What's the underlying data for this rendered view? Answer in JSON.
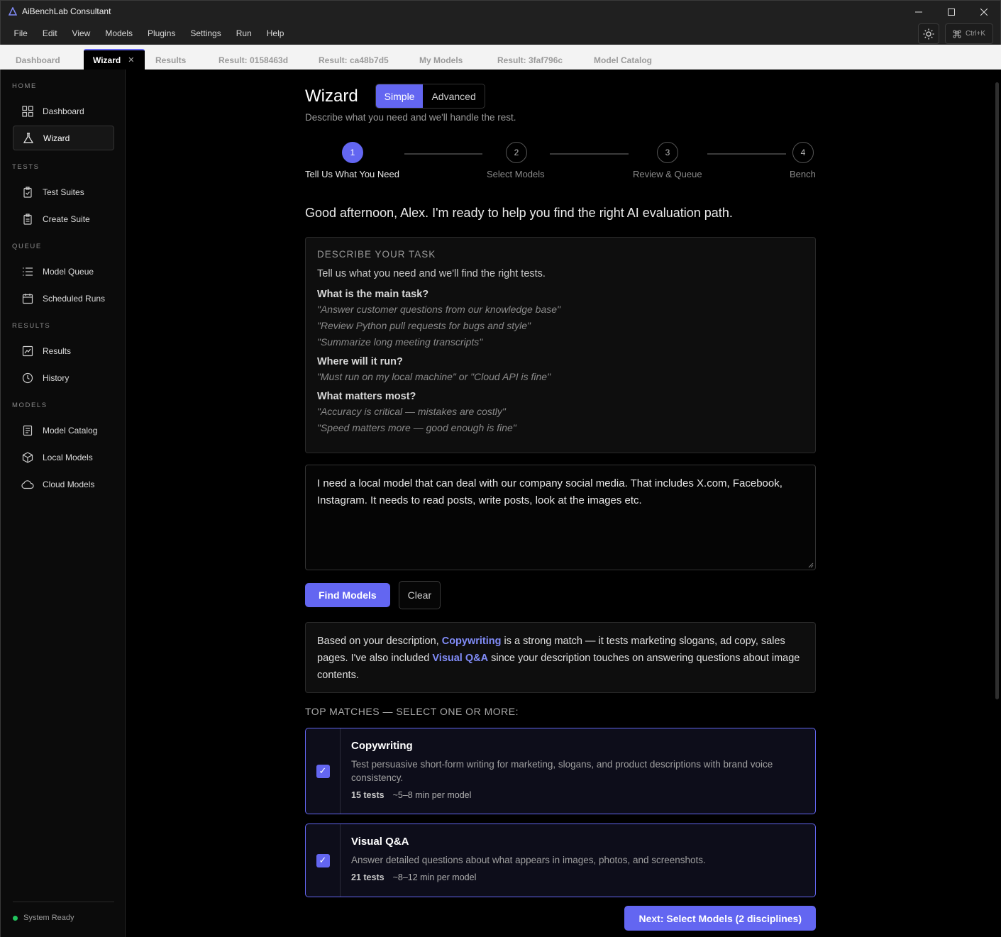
{
  "app": {
    "title": "AiBenchLab Consultant"
  },
  "menu": [
    "File",
    "Edit",
    "View",
    "Models",
    "Plugins",
    "Settings",
    "Run",
    "Help"
  ],
  "command": {
    "shortcut": "Ctrl+K"
  },
  "tabs": [
    {
      "label": "Dashboard",
      "active": false
    },
    {
      "label": "Wizard",
      "active": true
    },
    {
      "label": "Results",
      "active": false
    },
    {
      "label": "Result: 0158463d",
      "active": false
    },
    {
      "label": "Result: ca48b7d5",
      "active": false
    },
    {
      "label": "My Models",
      "active": false
    },
    {
      "label": "Result: 3faf796c",
      "active": false
    },
    {
      "label": "Model Catalog",
      "active": false
    }
  ],
  "sidebar": {
    "sections": [
      {
        "label": "HOME",
        "items": [
          {
            "label": "Dashboard",
            "icon": "grid-icon"
          },
          {
            "label": "Wizard",
            "icon": "flask-icon",
            "active": true
          }
        ]
      },
      {
        "label": "TESTS",
        "items": [
          {
            "label": "Test Suites",
            "icon": "clipboard-icon"
          },
          {
            "label": "Create Suite",
            "icon": "clipboard-plus-icon"
          }
        ]
      },
      {
        "label": "QUEUE",
        "items": [
          {
            "label": "Model Queue",
            "icon": "list-icon"
          },
          {
            "label": "Scheduled Runs",
            "icon": "calendar-icon"
          }
        ]
      },
      {
        "label": "RESULTS",
        "items": [
          {
            "label": "Results",
            "icon": "chart-icon"
          },
          {
            "label": "History",
            "icon": "clock-icon"
          }
        ]
      },
      {
        "label": "MODELS",
        "items": [
          {
            "label": "Model Catalog",
            "icon": "book-icon"
          },
          {
            "label": "Local Models",
            "icon": "cube-icon"
          },
          {
            "label": "Cloud Models",
            "icon": "cloud-icon"
          }
        ]
      }
    ],
    "status": "System Ready"
  },
  "wizard": {
    "title": "Wizard",
    "modes": [
      "Simple",
      "Advanced"
    ],
    "active_mode": "Simple",
    "subtitle": "Describe what you need and we'll handle the rest.",
    "steps": [
      {
        "num": "1",
        "label": "Tell Us What You Need",
        "active": true
      },
      {
        "num": "2",
        "label": "Select Models",
        "active": false
      },
      {
        "num": "3",
        "label": "Review & Queue",
        "active": false
      },
      {
        "num": "4",
        "label": "Bench",
        "active": false
      }
    ],
    "greeting": "Good afternoon, Alex. I'm ready to help you find the right AI evaluation path.",
    "describe": {
      "heading": "DESCRIBE YOUR TASK",
      "intro": "Tell us what you need and we'll find the right tests.",
      "questions": [
        {
          "title": "What is the main task?",
          "examples": [
            "\"Answer customer questions from our knowledge base\"",
            "\"Review Python pull requests for bugs and style\"",
            "\"Summarize long meeting transcripts\""
          ]
        },
        {
          "title": "Where will it run?",
          "examples": [
            "\"Must run on my local machine\" or \"Cloud API is fine\""
          ]
        },
        {
          "title": "What matters most?",
          "examples": [
            "\"Accuracy is critical — mistakes are costly\"",
            "\"Speed matters more — good enough is fine\""
          ]
        }
      ]
    },
    "input_text": "I need a local model that can deal with our company social media. That includes X.com, Facebook, Instagram. It needs to read posts, write posts, look at the images etc.",
    "find_label": "Find Models",
    "clear_label": "Clear",
    "explanation": {
      "p1": "Based on your description, ",
      "link1": "Copywriting",
      "p2": " is a strong match — it tests marketing slogans, ad copy, sales pages. I've also included ",
      "link2": "Visual Q&A",
      "p3": " since your description touches on answering questions about image contents."
    },
    "matches_heading": "TOP MATCHES — SELECT ONE OR MORE:",
    "matches": [
      {
        "title": "Copywriting",
        "desc": "Test persuasive short-form writing for marketing, slogans, and product descriptions with brand voice consistency.",
        "tests": "15 tests",
        "time": "~5–8 min per model",
        "checked": true
      },
      {
        "title": "Visual Q&A",
        "desc": "Answer detailed questions about what appears in images, photos, and screenshots.",
        "tests": "21 tests",
        "time": "~8–12 min per model",
        "checked": true
      }
    ],
    "next_label": "Next: Select Models (2 disciplines)"
  },
  "colors": {
    "accent": "#6366f1",
    "accent_text": "#818cf8",
    "status_ok": "#22c55e"
  }
}
